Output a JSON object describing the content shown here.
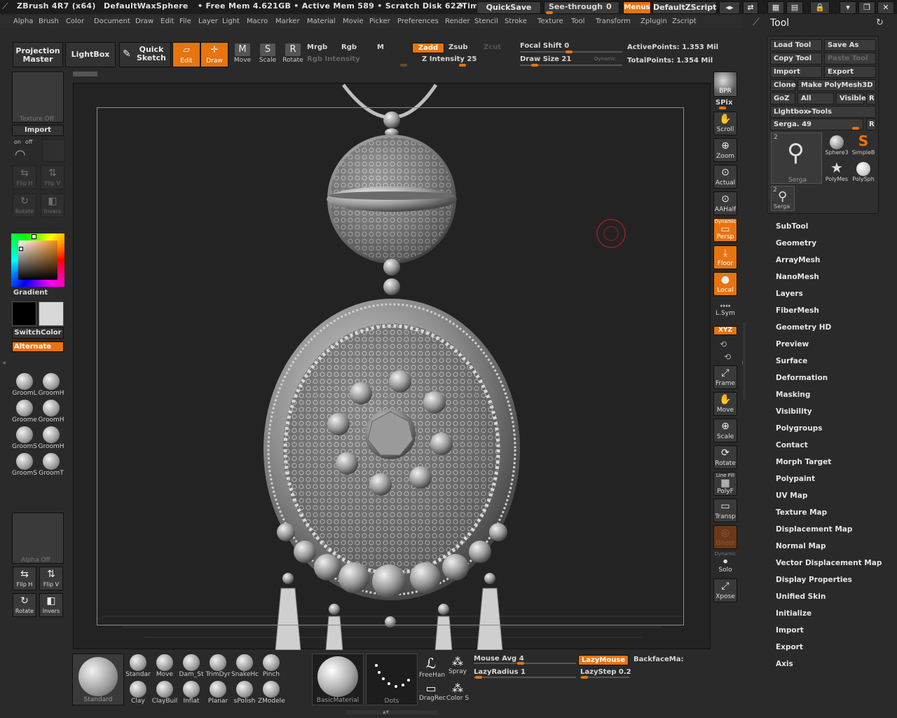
{
  "title": {
    "app": "ZBrush 4R7 (x64)",
    "doc": "DefaultWaxSphere",
    "mem": "• Free Mem 4.621GB • Active Mem 589 • Scratch Disk 62 •",
    "ztime": "ZTim",
    "quicksave": "QuickSave",
    "seethrough": "See-through",
    "seethrough_val": "0",
    "menus": "Menus",
    "script": "DefaultZScript"
  },
  "menu": [
    "Alpha",
    "Brush",
    "Color",
    "Document",
    "Draw",
    "Edit",
    "File",
    "Layer",
    "Light",
    "Macro",
    "Marker",
    "Material",
    "Movie",
    "Picker",
    "Preferences",
    "Render",
    "Stencil",
    "Stroke",
    "Texture",
    "Tool",
    "Transform",
    "Zplugin",
    "Zscript"
  ],
  "toolbar": {
    "projection_master": "Projection Master",
    "lightbox": "LightBox",
    "quick_sketch": "Quick Sketch",
    "edit": "Edit",
    "draw": "Draw",
    "move": "Move",
    "scale": "Scale",
    "rotate": "Rotate",
    "mrgb": "Mrgb",
    "rgb": "Rgb",
    "m": "M",
    "rgb_intensity": "Rgb Intensity",
    "zadd": "Zadd",
    "zsub": "Zsub",
    "zcut": "Zcut",
    "z_intensity": "Z Intensity 25",
    "focal_shift": "Focal Shift 0",
    "draw_size": "Draw Size 21",
    "dynamic": "Dynamic",
    "active_points": "ActivePoints: 1.353 Mil",
    "total_points": "TotalPoints: 1.354 Mil"
  },
  "left": {
    "texture_off": "Texture Off",
    "import": "Import",
    "on": "on",
    "off": "off",
    "flip_h": "Flip H",
    "flip_v": "Flip V",
    "rotate": "Rotate",
    "invers": "Invers",
    "gradient": "Gradient",
    "switchcolor": "SwitchColor",
    "alternate": "Alternate",
    "brushes": [
      "GroomL",
      "GroomH",
      "Groome",
      "GroomH",
      "GroomS",
      "GroomH",
      "GroomS",
      "GroomT"
    ],
    "alpha_off": "Alpha Off",
    "flip_h2": "Flip H",
    "flip_v2": "Flip V",
    "rotate2": "Rotate",
    "invers2": "Invers"
  },
  "right_shelf": {
    "bpr": "BPR",
    "spix": "SPix",
    "scroll": "Scroll",
    "zoom": "Zoom",
    "actual": "Actual",
    "aahalf": "AAHalf",
    "dynamic": "Dynamic",
    "persp": "Persp",
    "floor": "Floor",
    "local": "Local",
    "lsym": "L.Sym",
    "xyz": "XYZ",
    "frame": "Frame",
    "move": "Move",
    "scale": "Scale",
    "rotate": "Rotate",
    "linefill": "Line Fill",
    "polyf": "PolyF",
    "transp": "Transp",
    "ghost": "Ghost",
    "dynamic2": "Dynamic",
    "solo": "Solo",
    "xpose": "Xpose"
  },
  "tool": {
    "header": "Tool",
    "load_tool": "Load Tool",
    "save_as": "Save As",
    "copy_tool": "Copy Tool",
    "paste_tool": "Paste Tool",
    "import": "Import",
    "export": "Export",
    "clone": "Clone",
    "make_polymesh": "Make PolyMesh3D",
    "goz": "GoZ",
    "all": "All",
    "visible": "Visible",
    "r": "R",
    "lightbox_tools": "Lightbox▸Tools",
    "serga_slider": "Serga. 49",
    "r2": "R",
    "thumb_count": "2",
    "thumb_main": "Serga",
    "thumbs": [
      "Sphere3",
      "SimpleB",
      "PolyMes",
      "PolySph"
    ],
    "thumb_small_count": "2",
    "thumb_small": "Serga",
    "subpalettes": [
      "SubTool",
      "Geometry",
      "ArrayMesh",
      "NanoMesh",
      "Layers",
      "FiberMesh",
      "Geometry HD",
      "Preview",
      "Surface",
      "Deformation",
      "Masking",
      "Visibility",
      "Polygroups",
      "Contact",
      "Morph Target",
      "Polypaint",
      "UV Map",
      "Texture Map",
      "Displacement Map",
      "Normal Map",
      "Vector Displacement Map",
      "Display Properties",
      "Unified Skin",
      "Initialize",
      "Import",
      "Export",
      "Axis"
    ]
  },
  "bottom": {
    "current_brush": "Standard",
    "brushes_row1": [
      "Standar",
      "Move",
      "Dam_St",
      "TrimDyr",
      "SnakeHc",
      "Pinch"
    ],
    "brushes_row2": [
      "Clay",
      "ClayBuil",
      "Inflat",
      "Planar",
      "sPolish",
      "ZModele"
    ],
    "material": "BasicMaterial",
    "stroke": "Dots",
    "freehand": "FreeHan",
    "spray": "Spray",
    "dragrect": "DragRec",
    "color": "Color",
    "s": "S",
    "mouse_avg": "Mouse Avg 4",
    "lazy_radius": "LazyRadius 1",
    "lazymouse": "LazyMouse",
    "lazystep": "LazyStep 0.2",
    "backface": "BackfaceMa:"
  },
  "colors": {
    "accent": "#e7740f",
    "bg": "#2a2a2a",
    "viewport": "#232323"
  }
}
